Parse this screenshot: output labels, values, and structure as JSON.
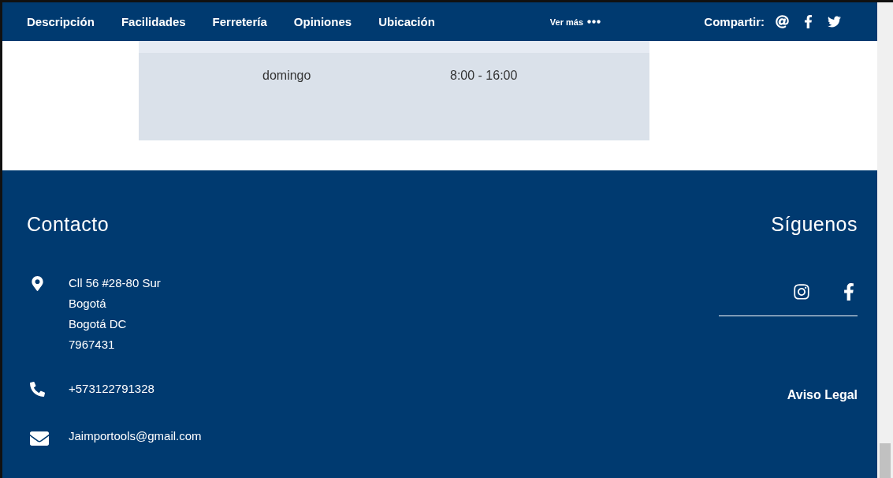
{
  "nav": {
    "links": [
      {
        "label": "Descripción"
      },
      {
        "label": "Facilidades"
      },
      {
        "label": "Ferretería"
      },
      {
        "label": "Opiniones"
      },
      {
        "label": "Ubicación"
      }
    ],
    "more": "Ver más",
    "share_label": "Compartir:",
    "share_icons": [
      {
        "kind": "email"
      },
      {
        "kind": "facebook"
      },
      {
        "kind": "twitter"
      }
    ]
  },
  "hours": [
    {
      "day": "domingo",
      "time": "8:00 - 16:00"
    }
  ],
  "footer": {
    "contact_title": "Contacto",
    "contact": [
      {
        "kind": "location",
        "lines": [
          "Cll 56 #28-80 Sur",
          "Bogotá",
          "Bogotá DC",
          "7967431"
        ]
      },
      {
        "kind": "phone",
        "lines": [
          "+573122791328"
        ]
      },
      {
        "kind": "email",
        "lines": [
          "Jaimportools@gmail.com"
        ]
      }
    ],
    "follow_title": "Síguenos",
    "social": [
      {
        "kind": "instagram"
      },
      {
        "kind": "facebook"
      }
    ],
    "legal": "Aviso Legal"
  }
}
